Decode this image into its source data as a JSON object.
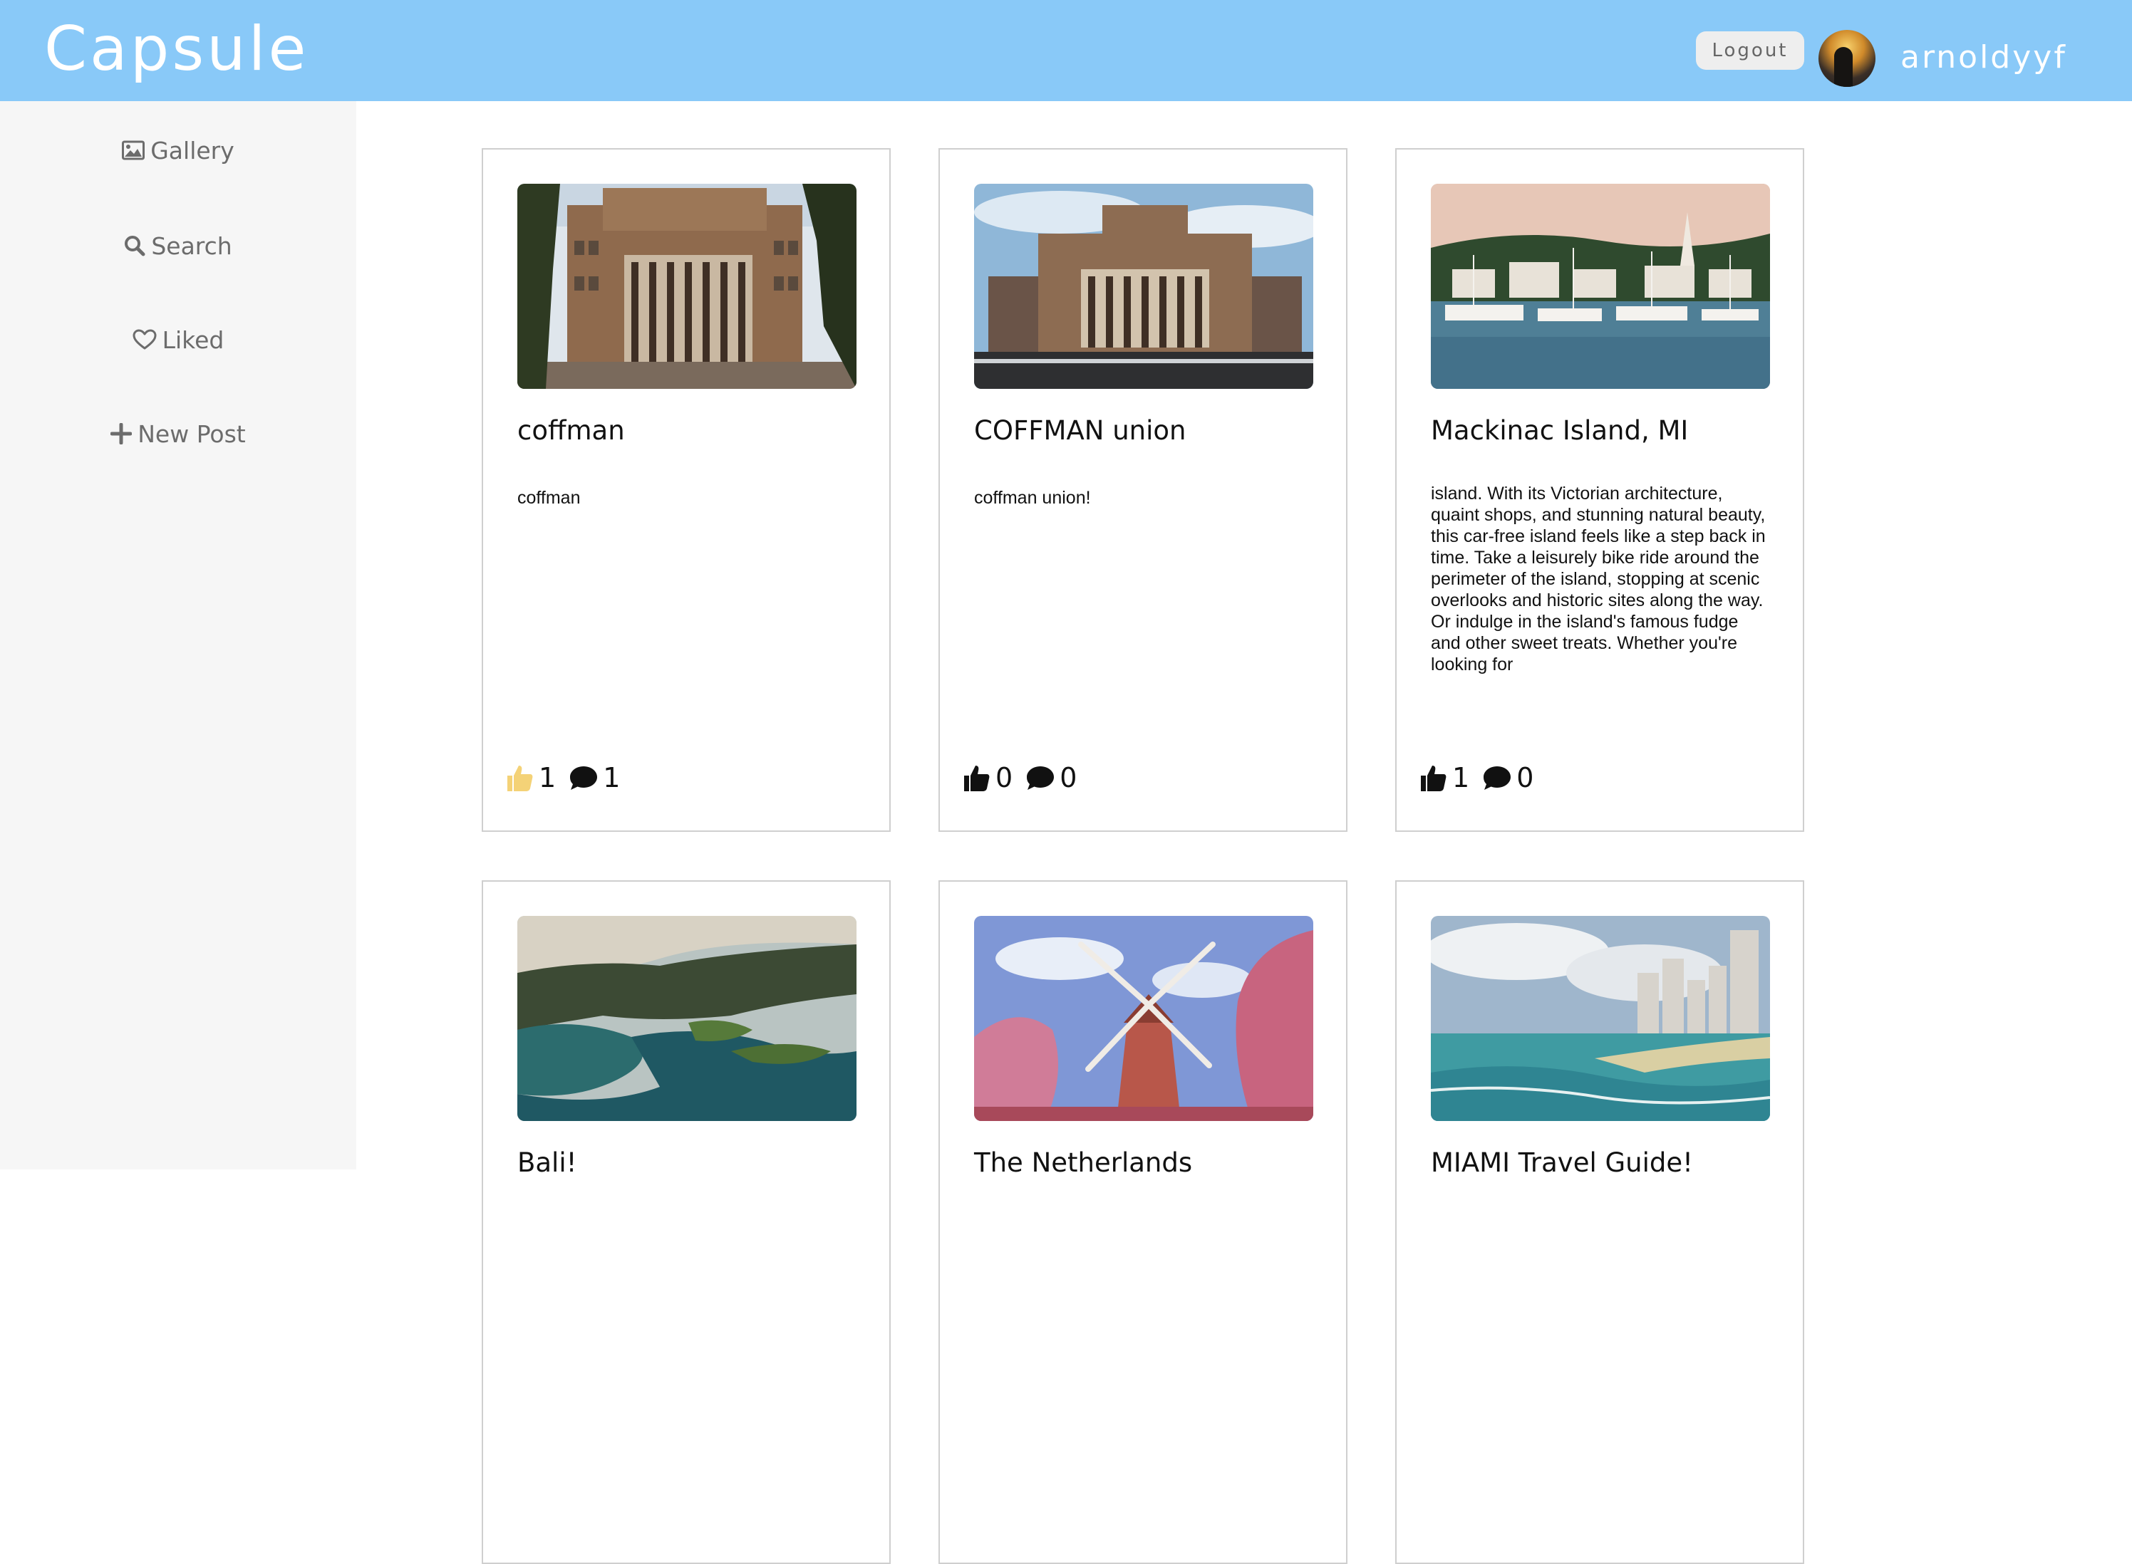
{
  "header": {
    "brand": "Capsule",
    "logout_label": "Logout",
    "username": "arnoldyyf",
    "background_color": "#89c9f8"
  },
  "sidebar": {
    "items": [
      {
        "label": "Gallery",
        "icon": "image-icon"
      },
      {
        "label": "Search",
        "icon": "search-icon"
      },
      {
        "label": "Liked",
        "icon": "heart-icon"
      },
      {
        "label": "New Post",
        "icon": "plus-icon"
      }
    ]
  },
  "posts": [
    {
      "title": "coffman",
      "description": "coffman",
      "likes": "1",
      "comments": "1",
      "liked": true,
      "image": "building-photo"
    },
    {
      "title": "COFFMAN union",
      "description": "coffman union!",
      "likes": "0",
      "comments": "0",
      "liked": false,
      "image": "building-photo"
    },
    {
      "title": "Mackinac Island, MI",
      "description": "island. With its Victorian architecture, quaint shops, and stunning natural beauty, this car-free island feels like a step back in time. Take a leisurely bike ride around the perimeter of the island, stopping at scenic overlooks and historic sites along the way. Or indulge in the island's famous fudge and other sweet treats. Whether you're looking for",
      "likes": "1",
      "comments": "0",
      "liked": false,
      "image": "harbor-photo"
    },
    {
      "title": "Bali!",
      "image": "coast-photo"
    },
    {
      "title": "The Netherlands",
      "image": "windmill-photo"
    },
    {
      "title": "MIAMI Travel Guide!",
      "image": "beach-photo"
    }
  ]
}
